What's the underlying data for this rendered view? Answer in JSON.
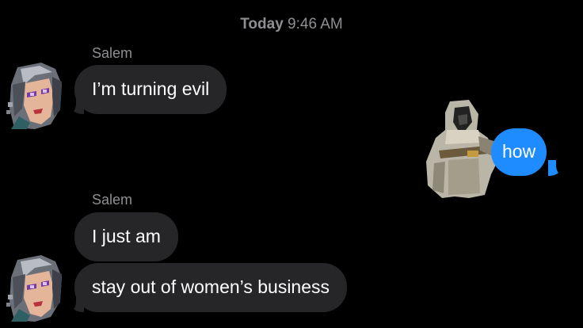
{
  "header": {
    "day": "Today",
    "time": "9:46 AM"
  },
  "messages": {
    "group1_sender": "Salem",
    "group1_text": "I’m turning evil",
    "outgoing_text": "how",
    "group2_sender": "Salem",
    "group2_text1": "I just am",
    "group2_text2": "stay out of women’s business"
  },
  "colors": {
    "incoming_bubble": "#262629",
    "outgoing_bubble": "#1e8cff",
    "meta_text": "#8e8e93"
  },
  "icons": {
    "avatar": "pixel-portrait-avatar",
    "sticker": "hooded-wanderer-sticker"
  }
}
